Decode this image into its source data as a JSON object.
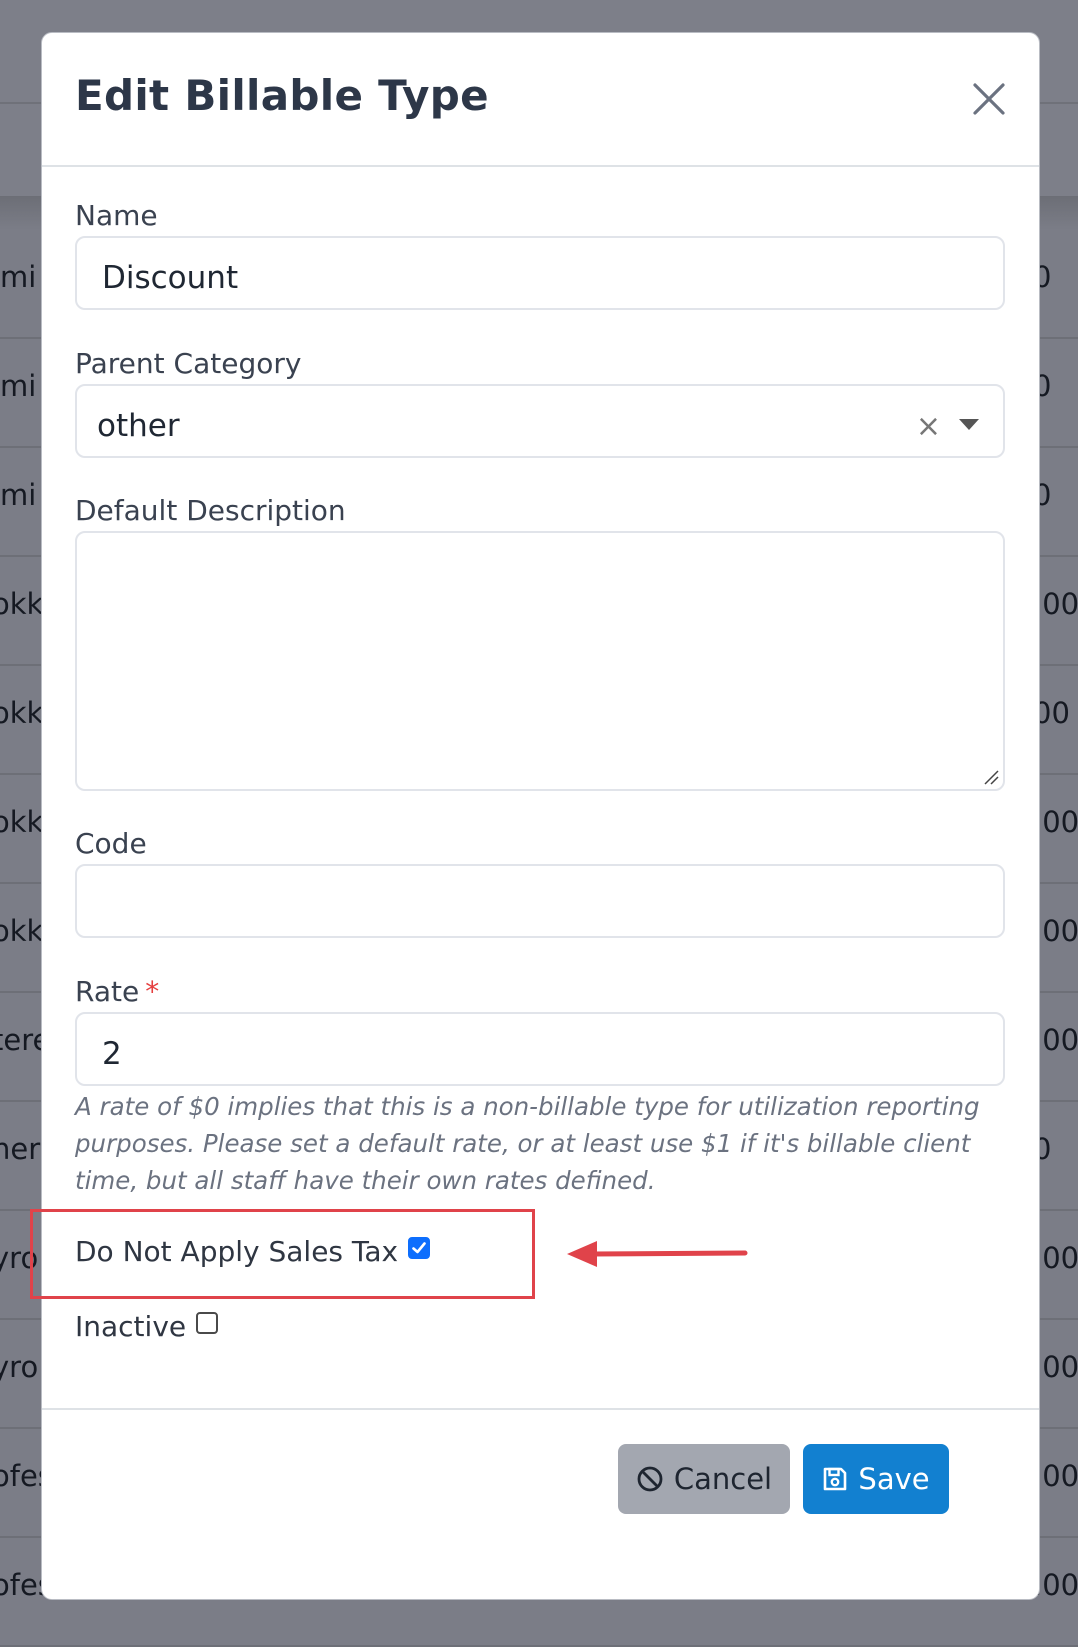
{
  "background": {
    "rows": [
      {
        "left": "lmi",
        "right": "0"
      },
      {
        "left": "lmi",
        "right": "0"
      },
      {
        "left": "lmi",
        "right": "0"
      },
      {
        "left": "okk",
        "right": ".00"
      },
      {
        "left": "okk",
        "right": "00"
      },
      {
        "left": "okk",
        "right": ".00"
      },
      {
        "left": "okk",
        "right": ".00"
      },
      {
        "left": "tere",
        "right": ".00"
      },
      {
        "left": "her",
        "right": "0"
      },
      {
        "left": "yro",
        "right": ".00"
      },
      {
        "left": "yro",
        "right": ".00"
      },
      {
        "left": "ofes",
        "right": ".00"
      },
      {
        "left": "ofes",
        "right": ".00"
      }
    ]
  },
  "modal": {
    "title": "Edit Billable Type",
    "close_icon": "close-icon",
    "fields": {
      "name": {
        "label": "Name",
        "value": "Discount"
      },
      "parent_category": {
        "label": "Parent Category",
        "value": "other",
        "clear_glyph": "×"
      },
      "default_description": {
        "label": "Default Description",
        "value": ""
      },
      "code": {
        "label": "Code",
        "value": ""
      },
      "rate": {
        "label": "Rate",
        "required_mark": "*",
        "value": "2"
      }
    },
    "help_text": "A rate of $0 implies that this is a non-billable type for utilization reporting purposes. Please set a default rate, or at least use $1 if it's billable client time, but all staff have their own rates defined.",
    "checkboxes": {
      "do_not_apply_sales_tax": {
        "label": "Do Not Apply Sales Tax",
        "checked": true
      },
      "inactive": {
        "label": "Inactive",
        "checked": false
      }
    },
    "footer": {
      "cancel_label": "Cancel",
      "cancel_icon": "ban-icon",
      "save_label": "Save",
      "save_icon": "floppy-disk-icon"
    }
  },
  "annotation": {
    "highlight_color": "#e0434a",
    "arrow_color": "#e0434a"
  },
  "colors": {
    "overlay": "#7b7d87",
    "primary": "#1280d0",
    "secondary": "#a3a7b0",
    "checkbox_checked": "#0d6efd"
  }
}
